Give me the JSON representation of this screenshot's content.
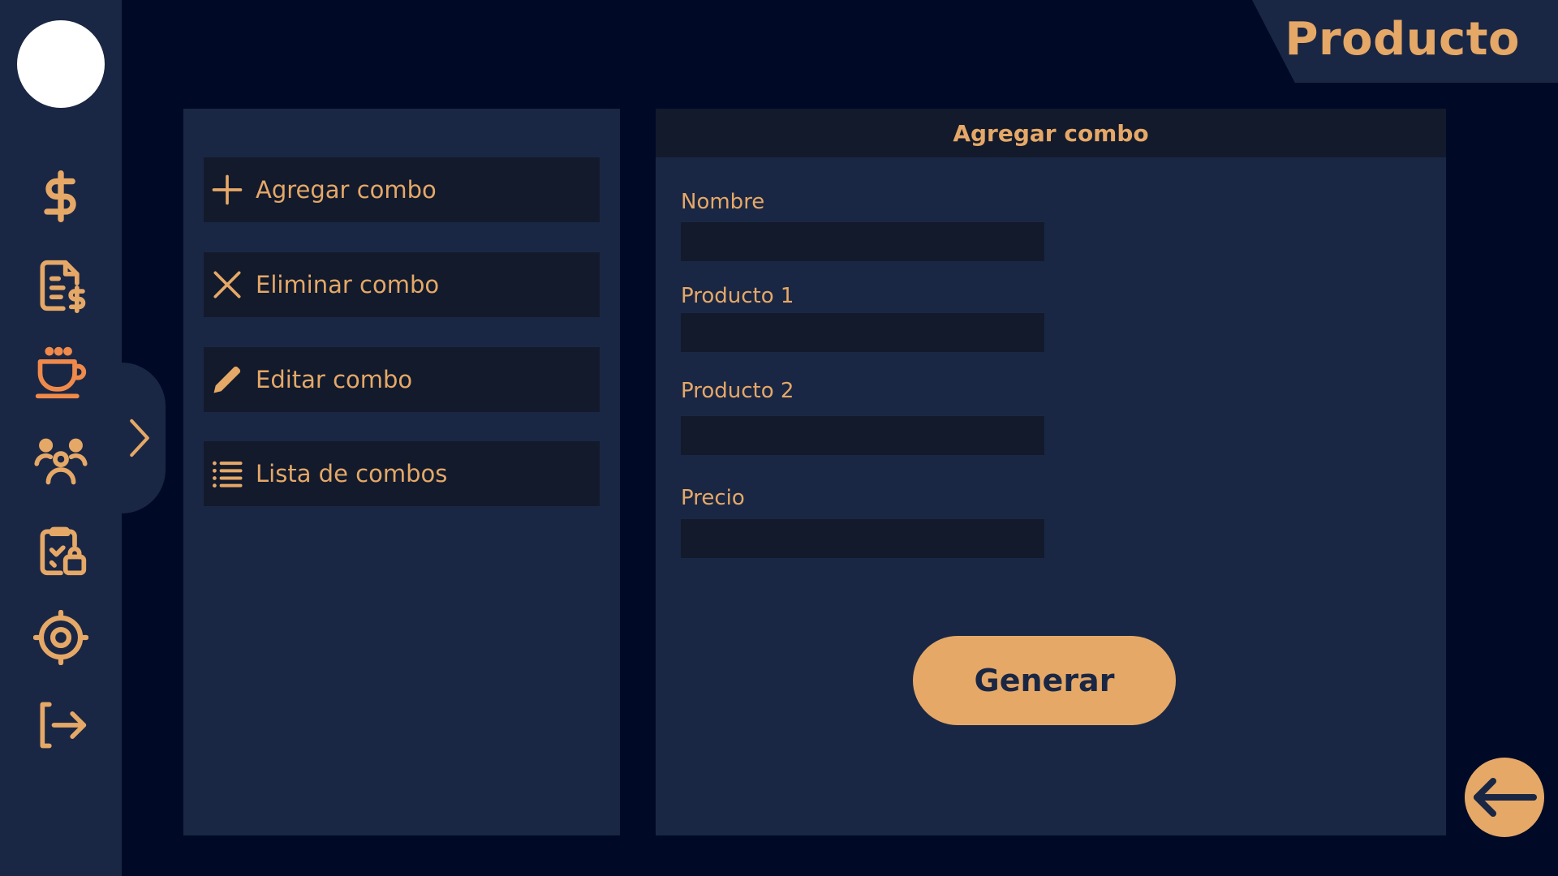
{
  "header": {
    "title": "Producto"
  },
  "sidebar": {
    "icons": [
      {
        "name": "dollar-icon",
        "color": "#e5a867"
      },
      {
        "name": "invoice-icon",
        "color": "#e5a867"
      },
      {
        "name": "coffee-cup-icon",
        "color": "#f08a4b",
        "active": true
      },
      {
        "name": "users-icon",
        "color": "#e5a867"
      },
      {
        "name": "clipboard-lock-icon",
        "color": "#e5a867"
      },
      {
        "name": "gear-icon",
        "color": "#e5a867"
      },
      {
        "name": "logout-icon",
        "color": "#e5a867"
      }
    ]
  },
  "menu": {
    "items": [
      {
        "label": "Agregar combo",
        "icon": "plus-icon"
      },
      {
        "label": "Eliminar combo",
        "icon": "close-icon"
      },
      {
        "label": "Editar combo",
        "icon": "pencil-icon"
      },
      {
        "label": "Lista de combos",
        "icon": "list-icon"
      }
    ]
  },
  "form": {
    "title": "Agregar combo",
    "fields": [
      {
        "label": "Nombre",
        "value": ""
      },
      {
        "label": "Producto 1",
        "value": ""
      },
      {
        "label": "Producto 2",
        "value": ""
      },
      {
        "label": "Precio",
        "value": ""
      }
    ],
    "submit_label": "Generar"
  },
  "colors": {
    "background": "#000a26",
    "panel": "#1a2744",
    "field": "#121a2c",
    "accent": "#e5a867",
    "active_icon": "#f08a4b"
  }
}
